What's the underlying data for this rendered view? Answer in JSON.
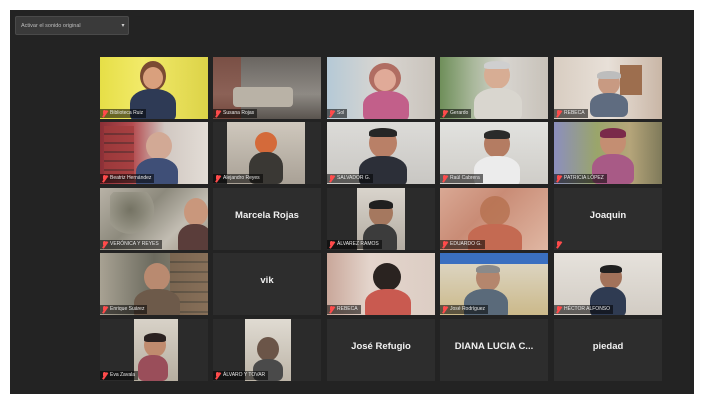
{
  "toolbar": {
    "translation_dropdown": "Activar el sonido original"
  },
  "tiles": [
    {
      "name": "Biblioteca Ruiz"
    },
    {
      "name": "Susana Rojas"
    },
    {
      "name": "Sol"
    },
    {
      "name": "Gerardo"
    },
    {
      "name": "REBECA"
    },
    {
      "name": "Beatriz Hernández"
    },
    {
      "name": "Alejandro Reyes"
    },
    {
      "name": "SALVADOR G."
    },
    {
      "name": "Raúl Cabrera"
    },
    {
      "name": "PATRICIA LÓPEZ"
    },
    {
      "name": "VERÓNICA Y REYES"
    },
    {
      "name": "Marcela Rojas",
      "big": "Marcela Rojas"
    },
    {
      "name": "ÁLVAREZ RAMOS"
    },
    {
      "name": "EDUARDO G."
    },
    {
      "name": "Joaquin",
      "big": "Joaquin"
    },
    {
      "name": "Enrique Suárez"
    },
    {
      "name": "vik",
      "big": "vik"
    },
    {
      "name": "REBECA"
    },
    {
      "name": "José Rodríguez"
    },
    {
      "name": "HÉCTOR ALFONSO"
    },
    {
      "name": "Eva Zavala"
    },
    {
      "name": "ÁLVARO Y TOVAR"
    },
    {
      "name": "José Refugio",
      "big": "José Refugio"
    },
    {
      "name": "DIANA LUCIA C...",
      "big": "DIANA LUCIA C..."
    },
    {
      "name": "piedad",
      "big": "piedad"
    }
  ]
}
